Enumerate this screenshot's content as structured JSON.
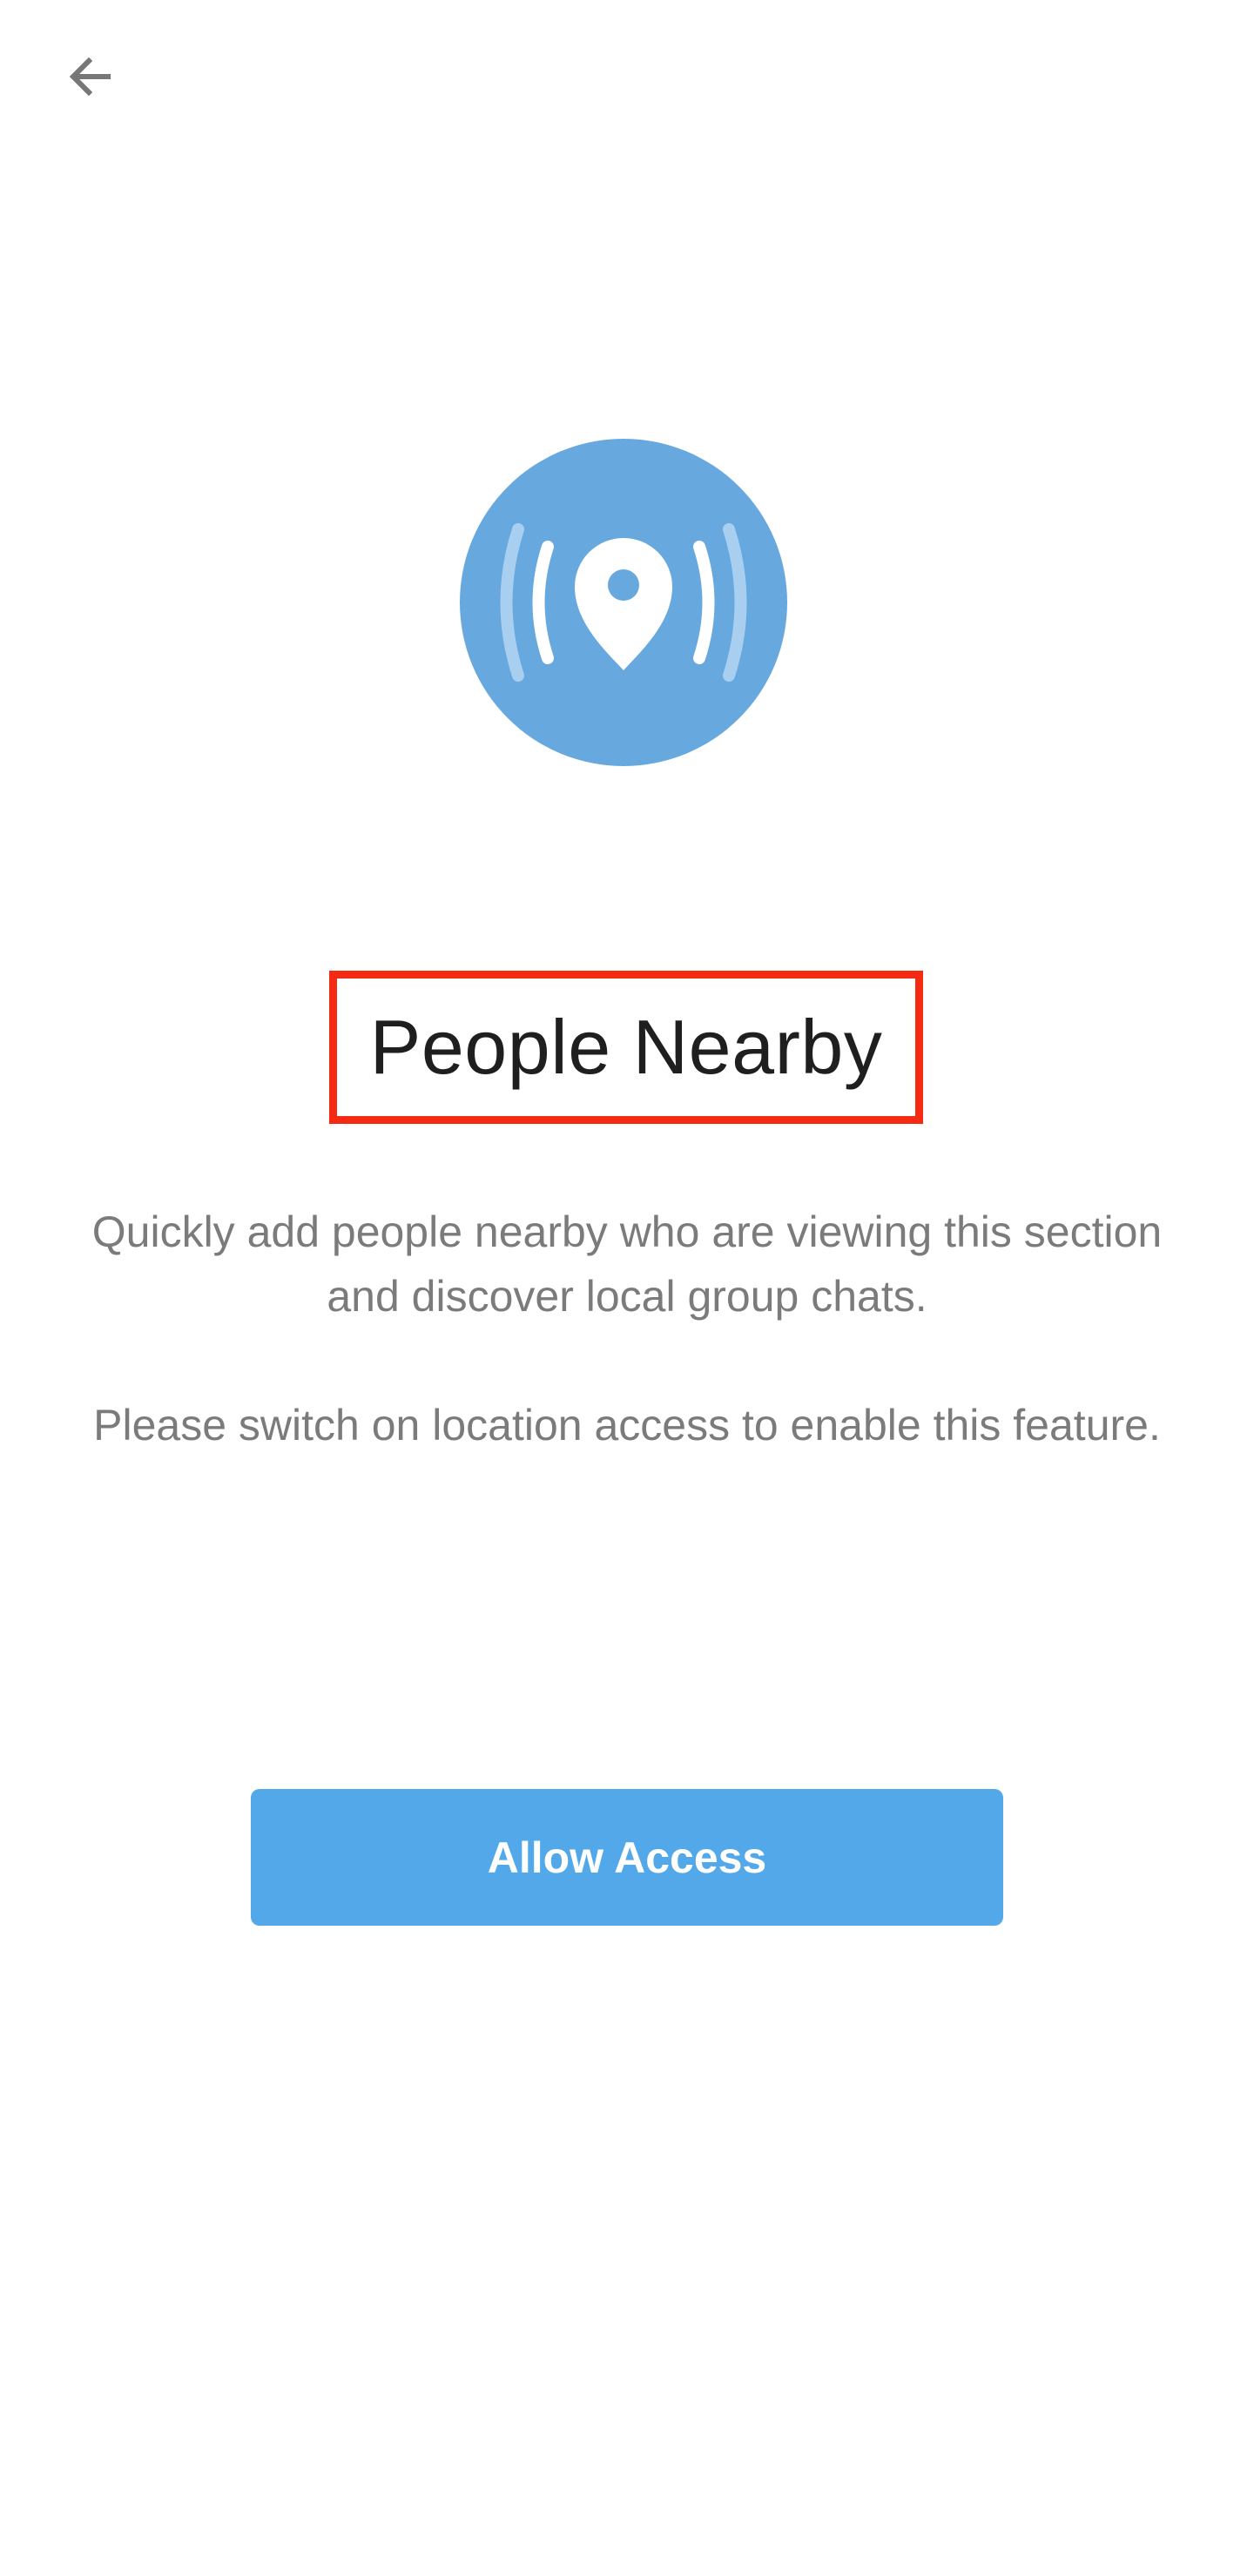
{
  "toolbar": {
    "back_icon": "arrow-left-icon"
  },
  "hero": {
    "icon": "location-broadcast-icon",
    "circle_color": "#67a8df"
  },
  "main": {
    "title": "People Nearby",
    "description": "Quickly add people nearby who are viewing this section and discover local group chats.",
    "location_notice": "Please switch on location access to enable this feature.",
    "allow_access_label": "Allow Access"
  },
  "colors": {
    "accent": "#52a8e8",
    "highlight_border": "#f42a12",
    "title_text": "#1f1f1f",
    "body_text": "#7b7b7b",
    "icon_gray": "#777777"
  }
}
